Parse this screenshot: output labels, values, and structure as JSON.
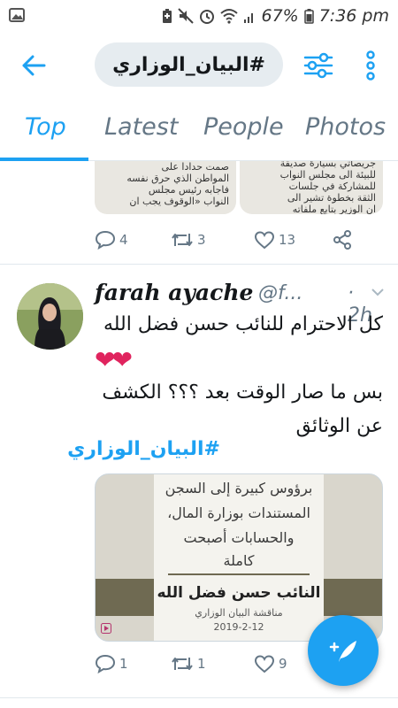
{
  "status_bar": {
    "battery_percent": "67%",
    "time": "7:36 pm"
  },
  "header": {
    "search_query": "#البيان_الوزاري",
    "back_icon": "arrow-left-icon",
    "filter_icon": "sliders-icon",
    "more_icon": "vertical-dots-icon"
  },
  "tabs": [
    {
      "label": "Top",
      "active": true
    },
    {
      "label": "Latest",
      "active": false
    },
    {
      "label": "People",
      "active": false
    },
    {
      "label": "Photos",
      "active": false
    }
  ],
  "prev_tweet": {
    "image_left_text": [
      "صمت حدادا على",
      "المواطن الذي حرق نفسه",
      "فاجابه رئيس مجلس",
      "النواب «الوقوف يجب ان"
    ],
    "image_right_text": [
      "جريصاتي بسيارة صديقة",
      "للبيئة الى مجلس النواب",
      "للمشاركة في جلسات",
      "الثقة بخطوة تشير الى",
      "ان الوزير بتابع ملفاته"
    ],
    "actions": {
      "replies": "4",
      "retweets": "3",
      "likes": "13"
    }
  },
  "tweet": {
    "display_name": "farah ayache",
    "handle": "@f...",
    "time": "· 2h",
    "text_1": "كل الاحترام للنائب حسن فضل الله",
    "hearts": "❤❤",
    "text_2": "بس ما صار الوقت بعد ؟؟؟ الكشف عن الوثائق",
    "hashtag": "#البيان_الوزاري",
    "media": {
      "line_1": "برؤوس كبيرة إلى السجن",
      "line_2": "المستندات بوزارة المال،",
      "line_3": "والحسابات أصبحت",
      "line_4": "كاملة",
      "name": "النائب حسن فضل الله",
      "subtitle": "مناقشة البيان الوزاري",
      "date": "2019-2-12"
    },
    "actions": {
      "replies": "1",
      "retweets": "1",
      "likes": "9"
    }
  },
  "colors": {
    "accent": "#1da1f2",
    "muted": "#657786",
    "heart": "#e0245e"
  }
}
